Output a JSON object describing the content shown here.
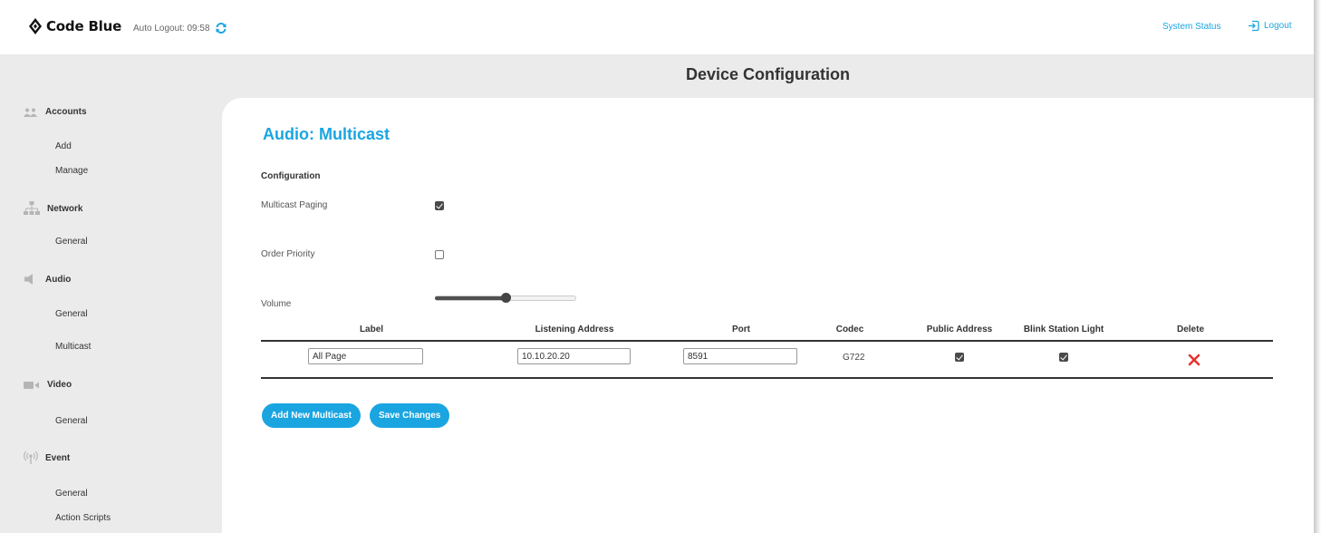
{
  "app": {
    "name": "Code Blue",
    "auto_logout": "Auto Logout: 09:58",
    "refresh_icon": "refresh-icon",
    "brand_color": "#1aa5e1"
  },
  "header": {
    "system_status": "System Status",
    "logout": "Logout",
    "logout_icon": "logout-icon"
  },
  "page": {
    "title": "Device Configuration"
  },
  "sidebar": {
    "sections": [
      {
        "label": "Accounts",
        "icon": "users-icon",
        "items": [
          "Add",
          "Manage"
        ]
      },
      {
        "label": "Network",
        "icon": "network-icon",
        "items": [
          "General"
        ]
      },
      {
        "label": "Audio",
        "icon": "speaker-icon",
        "items": [
          "General",
          "Multicast"
        ]
      },
      {
        "label": "Video",
        "icon": "video-camera-icon",
        "items": [
          "General"
        ]
      },
      {
        "label": "Event",
        "icon": "broadcast-icon",
        "items": [
          "General",
          "Action Scripts"
        ]
      }
    ]
  },
  "main": {
    "section_title": "Audio: Multicast",
    "config_heading": "Configuration",
    "multicast_paging": {
      "label": "Multicast Paging",
      "checked": true
    },
    "order_priority": {
      "label": "Order Priority",
      "checked": false
    },
    "volume": {
      "label": "Volume",
      "level_fraction": 0.5
    },
    "table": {
      "headers": [
        "Label",
        "Listening Address",
        "Port",
        "Codec",
        "Public Address",
        "Blink Station Light",
        "Delete"
      ],
      "rows": [
        {
          "label": "All Page",
          "listening_address": "10.10.20.20",
          "port": "8591",
          "codec": "G722",
          "public_address": true,
          "blink_station_light": true,
          "delete_icon": "delete-x-icon",
          "delete_color": "#e8322f"
        }
      ]
    },
    "buttons": {
      "add": "Add New Multicast",
      "save": "Save Changes"
    }
  }
}
